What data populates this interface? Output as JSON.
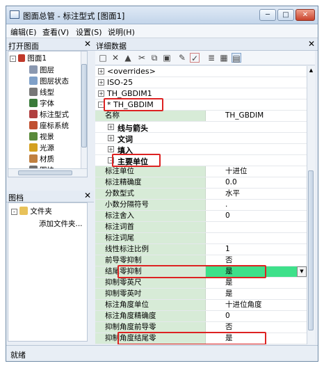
{
  "window": {
    "title": "图面总管 - 标注型式 [图面1]",
    "btn_min": "─",
    "btn_max": "□",
    "btn_close": "✕"
  },
  "menu": [
    "编辑(E)",
    "查看(V)",
    "设置(S)",
    "说明(H)"
  ],
  "left_panel": {
    "title": "打开图面",
    "close": "✕",
    "root": "图面1",
    "items": [
      {
        "label": "图层",
        "icon": "layers-icon",
        "color": "#8a98b0"
      },
      {
        "label": "图层状态",
        "icon": "layer-state-icon",
        "color": "#7fa0c8"
      },
      {
        "label": "线型",
        "icon": "linetype-icon",
        "color": "#777777"
      },
      {
        "label": "字体",
        "icon": "font-icon",
        "color": "#3a7a3a"
      },
      {
        "label": "标注型式",
        "icon": "dimstyle-icon",
        "color": "#b04040"
      },
      {
        "label": "座标系统",
        "icon": "ucs-icon",
        "color": "#c05030"
      },
      {
        "label": "视景",
        "icon": "view-icon",
        "color": "#5a8a3a"
      },
      {
        "label": "光源",
        "icon": "light-icon",
        "color": "#d4a020"
      },
      {
        "label": "材质",
        "icon": "material-icon",
        "color": "#c08040"
      },
      {
        "label": "图块",
        "icon": "block-icon",
        "color": "#707070"
      }
    ]
  },
  "docs_panel": {
    "title": "图档",
    "close": "✕",
    "folder": "文件夹",
    "add": "添加文件夹..."
  },
  "status": "就绪",
  "detail_panel": {
    "title": "详细数据",
    "close": "✕"
  },
  "tree_rows": [
    {
      "kind": "cat",
      "lbl": "<overrides>",
      "sign": "+"
    },
    {
      "kind": "cat",
      "lbl": "ISO-25",
      "sign": "+"
    },
    {
      "kind": "cat",
      "lbl": "TH_GBDIM1",
      "sign": "+"
    },
    {
      "kind": "cat",
      "lbl": "* TH_GBDIM",
      "sign": "-"
    },
    {
      "kind": "prop",
      "name": "名称",
      "value": "TH_GBDIM"
    },
    {
      "kind": "sub",
      "lbl": "线与箭头",
      "sign": "+"
    },
    {
      "kind": "sub",
      "lbl": "文词",
      "sign": "+"
    },
    {
      "kind": "sub",
      "lbl": "填入",
      "sign": "+"
    },
    {
      "kind": "sub",
      "lbl": "主要单位",
      "sign": "-"
    },
    {
      "kind": "prop",
      "name": "标注单位",
      "value": "十进位"
    },
    {
      "kind": "prop",
      "name": "标注精确度",
      "value": "0.0"
    },
    {
      "kind": "prop",
      "name": "分数型式",
      "value": "水平"
    },
    {
      "kind": "prop",
      "name": "小数分隔符号",
      "value": "."
    },
    {
      "kind": "prop",
      "name": "标注舍入",
      "value": "0"
    },
    {
      "kind": "prop",
      "name": "标注词首",
      "value": ""
    },
    {
      "kind": "prop",
      "name": "标注词尾",
      "value": ""
    },
    {
      "kind": "prop",
      "name": "线性标注比例",
      "value": "1"
    },
    {
      "kind": "prop",
      "name": "前导零抑制",
      "value": "否"
    },
    {
      "kind": "prop",
      "name": "结尾零抑制",
      "value": "是",
      "selected": true
    },
    {
      "kind": "prop",
      "name": "抑制零英尺",
      "value": "是"
    },
    {
      "kind": "prop",
      "name": "抑制零英吋",
      "value": "是"
    },
    {
      "kind": "prop",
      "name": "标注角度单位",
      "value": "十进位角度"
    },
    {
      "kind": "prop",
      "name": "标注角度精确度",
      "value": "0"
    },
    {
      "kind": "prop",
      "name": "抑制角度前导零",
      "value": "否"
    },
    {
      "kind": "prop",
      "name": "抑制角度结尾零",
      "value": "是"
    }
  ],
  "colors": {
    "highlight_border": "#dd2222",
    "selected_value": "#3ee08a",
    "prop_name_bg": "#d7ebd7"
  }
}
